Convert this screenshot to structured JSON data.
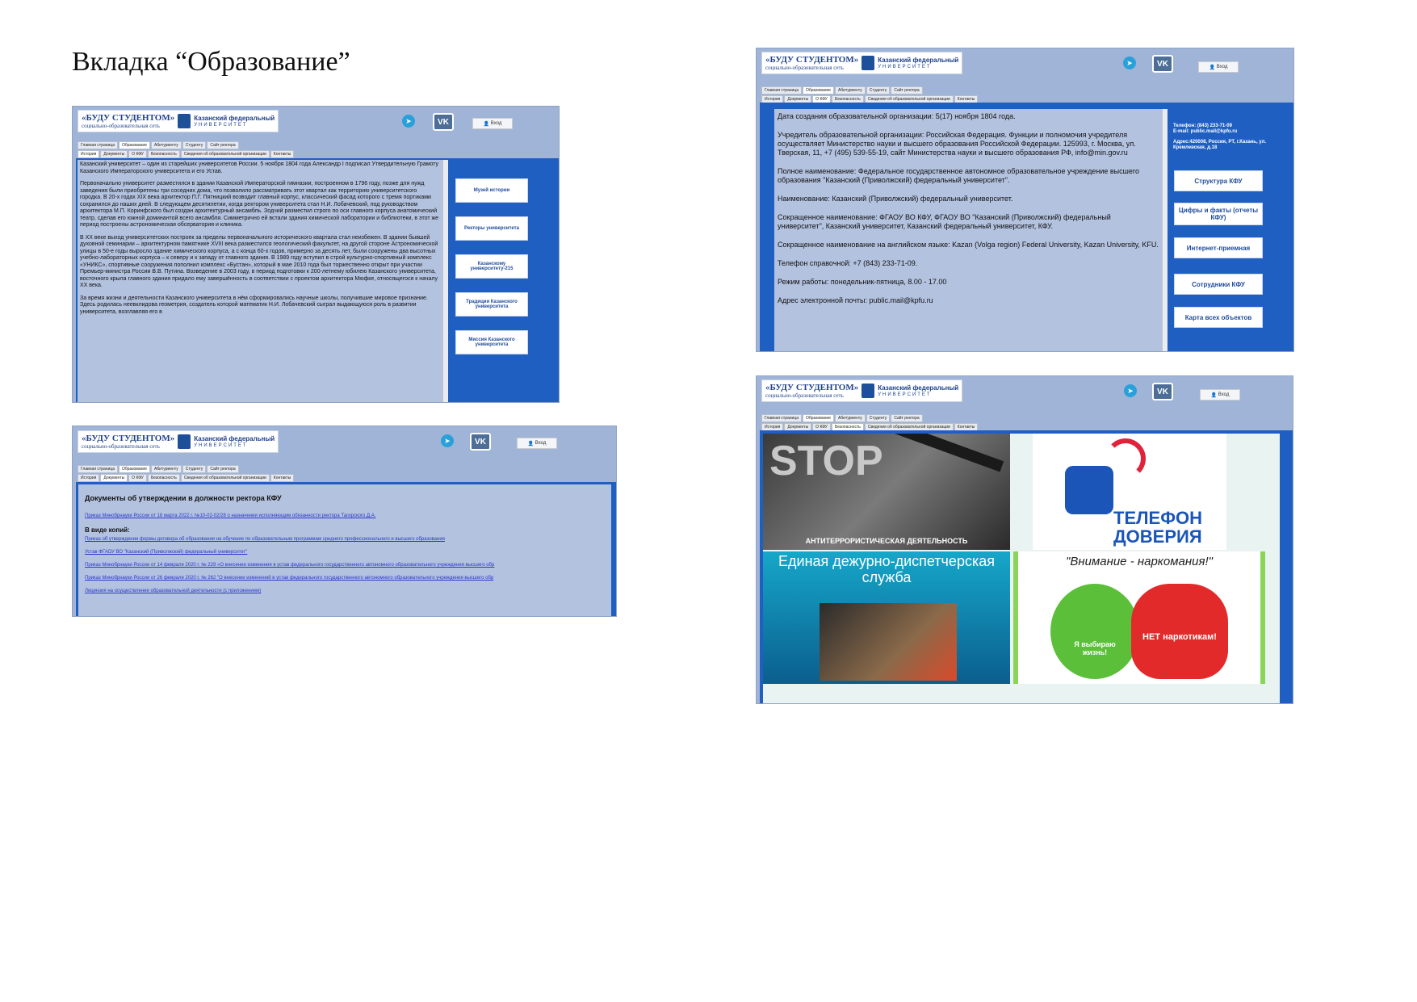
{
  "page": {
    "heading": "Вкладка “Образование”"
  },
  "site": {
    "logo_line1": "«БУДУ СТУДЕНТОМ»",
    "logo_line2": "социально-образовательная сеть",
    "logo_univ1": "Казанский федеральный",
    "logo_univ2": "УНИВЕРСИТЕТ",
    "login_label": "Вход",
    "telegram_icon": "telegram-icon",
    "vk_label": "VK",
    "main_tabs": [
      "Главная страница",
      "Образование",
      "Абитуриенту",
      "Студенту",
      "Сайт ректора"
    ],
    "sub_tabs": [
      "История",
      "Документы",
      "О КФУ",
      "Безопасность",
      "Сведения об образовательной организации",
      "Контакты"
    ],
    "colors": {
      "bg": "#9fb4d6",
      "frame": "#1f5fc2",
      "panel": "#b3c2df",
      "link": "#2a38c9"
    }
  },
  "history": {
    "paragraphs": [
      "Казанский университет – один из старейших университетов России. 5 ноября 1804 года Александр I подписал Утвердительную Грамоту Казанского Императорского университета и его Устав.",
      "Первоначально университет разместился в здании Казанской Императорской гимназии, построенном в 1796 году, позже для нужд заведения были приобретены три соседних дома, что позволило рассматривать этот квартал как территорию университетского городка. В 20-х годах XIX века архитектор П.Г. Пятницкий возводит главный корпус, классический фасад которого с тремя портиками сохранился до наших дней. В следующем десятилетии, когда ректором университета стал Н.И. Лобачевский, под руководством архитектора М.П. Коринфского был создан архитектурный ансамбль. Зодчий разместил строго по оси главного корпуса анатомический театр, сделав его южной доминантой всего ансамбля. Симметрично ей встали здания химической лаборатории и библиотеки, в этот же период построены астрономическая обсерватория и клиника.",
      "В XX веке выход университетских построек за пределы первоначального исторического квартала стал неизбежен. В здании бывшей духовной семинарии – архитектурном памятнике XVIII века разместился геологический факультет, на другой стороне Астрономической улицы в 50-е годы выросло здание химического корпуса, а с конца 60-х годов, примерно за десять лет, были сооружены два высотных учебно-лабораторных корпуса – к северу и к западу от главного здания. В 1989 году вступил в строй культурно-спортивный комплекс «УНИКС», спортивные сооружения пополнил комплекс «Бустан», который в мае 2010 года был торжественно открыт при участии Премьер-министра России В.В. Путина. Возведение в 2003 году, в период подготовки к 200-летнему юбилею Казанского университета, восточного крыла главного здания придало ему завершённость в соответствии с проектом архитектора Мюфке, относящегося к началу XX века.",
      "За время жизни и деятельности Казанского университета в нём сформировались научные школы, получившие мировое признание. Здесь родилась неевклидова геометрия, создатель которой математик Н.И. Лобачевский сыграл выдающуюся роль в развитии университета, возглавляя его в"
    ],
    "buttons": [
      "Музей истории",
      "Ректоры университета",
      "Казанскому университету-215",
      "Традиции Казанского университета",
      "Миссия Казанского университета"
    ]
  },
  "documents": {
    "heading": "Документы об утверждении в должности ректора КФУ",
    "link1": "Приказ Минобрнауки России от 18 марта 2022 г. №10-02-02/28 о назначении исполняющим обязанности ректора Тагирского Д.А.",
    "copies_heading": "В виде копий:",
    "links": [
      "Приказ об утверждении формы договора об образовании на обучение по образовательным программам среднего профессионального и высшего образования",
      "Устав ФГАОУ ВО \"Казанский (Приволжский) федеральный университет\"",
      "Приказ Минобрнауки России от 14 февраля 2020 г. № 229 «О внесении изменения в устав федерального государственного автономного образовательного учреждения высшего обр",
      "Приказ Минобрнауки России от 26 февраля 2020 г. № 262 \"О внесении изменений в устав федерального государственного автономного образовательного учреждения высшего обр",
      "Лицензия на осуществление образовательной деятельности (с приложением)"
    ]
  },
  "about": {
    "lines": [
      "Дата создания образовательной организации: 5(17) ноября 1804 года.",
      "Учредитель образовательной организации: Российская Федерация. Функции и полномочия учредителя осуществляет Министерство науки и высшего образования Российской Федерации. 125993, г. Москва, ул. Тверская, 11, +7 (495) 539-55-19, сайт Министерства науки и высшего образования РФ, info@min.gov.ru",
      "Полное наименование: Федеральное государственное автономное образовательное учреждение высшего образования \"Казанский (Приволжский) федеральный университет\".",
      "Наименование: Казанский (Приволжский) федеральный университет.",
      "Сокращенное наименование: ФГАОУ ВО КФУ, ФГАОУ ВО \"Казанский (Приволжский) федеральный университет\", Казанский университет, Казанский федеральный университет, КФУ.",
      "Сокращенное наименование на английском языке: Kazan (Volga region) Federal University, Kazan University, KFU.",
      "Телефон справочной: +7 (843) 233-71-09.",
      "Режим работы: понедельник-пятница, 8.00 - 17.00",
      "Адрес электронной почты: public.mail@kpfu.ru"
    ],
    "contact_phone": "Телефон: (843) 233-71-09",
    "contact_email": "E-mail: public.mail@kpfu.ru",
    "contact_addr": "Адрес:420008, Россия, РТ, г.Казань, ул. Кремлевская, д.18",
    "buttons": [
      "Структура КФУ",
      "Цифры и факты (отчеты КФУ)",
      "Интернет-приемная",
      "Сотрудники КФУ",
      "Карта всех объектов"
    ]
  },
  "security": {
    "stop_word": "STOP",
    "anti_terror": "АНТИТЕРРОРИСТИЧЕСКАЯ ДЕЯТЕЛЬНОСТЬ",
    "phone_line1": "ТЕЛЕФОН",
    "phone_line2": "ДОВЕРИЯ",
    "dispatch": "Единая дежурно-диспетчерская служба",
    "narco": "\"Внимание - наркомания!\"",
    "choose_life": "Я выбираю жизнь!",
    "no_drugs": "НЕТ наркотикам!"
  }
}
